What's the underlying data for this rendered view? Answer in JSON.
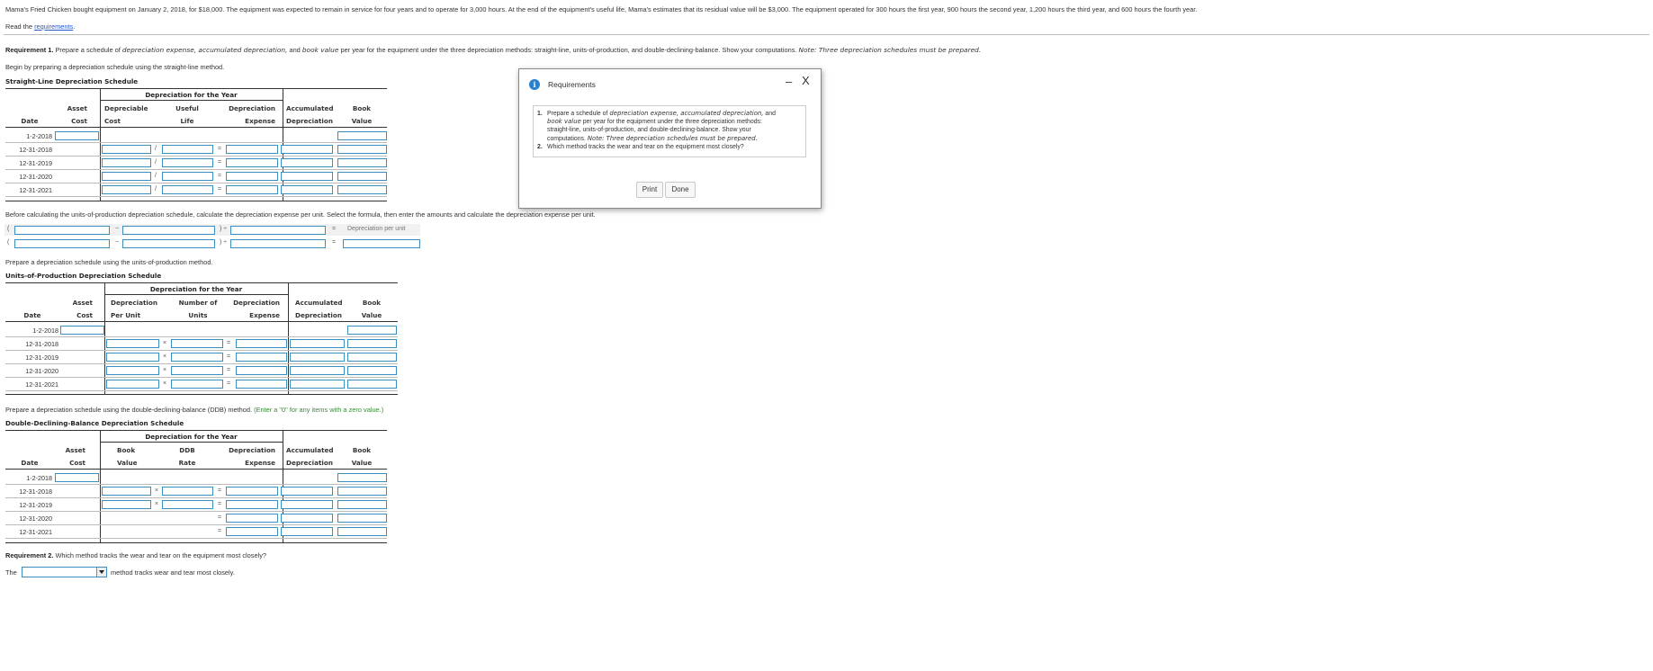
{
  "intro": {
    "problem": "Mama's Fried Chicken bought equipment on January 2, 2018, for $18,000. The equipment was expected to remain in service for four years and to operate for 3,000 hours. At the end of the equipment's useful life, Mama's estimates that its residual value will be $3,000. The equipment operated for 300 hours the first year, 900 hours the second year, 1,200 hours the third year, and 600 hours the fourth year.",
    "read_prefix": "Read the ",
    "read_link": "requirements",
    "read_suffix": "."
  },
  "req1": {
    "label": "Requirement 1.",
    "text_a": " Prepare a schedule of ",
    "term1": "depreciation expense, accumulated depreciation,",
    "text_b": " and ",
    "term2": "book value",
    "text_c": " per year for the equipment under the three depreciation methods: straight-line, units-of-production, and double-declining-balance. Show your computations. ",
    "note": "Note: Three depreciation schedules must be prepared.",
    "begin": "Begin by preparing a depreciation schedule using the straight-line method."
  },
  "sl": {
    "title": "Straight-Line Depreciation Schedule",
    "group_header": "Depreciation for the Year",
    "col_asset_1": "Asset",
    "col_asset_2": "Cost",
    "col_a_1": "Depreciable",
    "col_a_2": "Cost",
    "col_b_1": "Useful",
    "col_b_2": "Life",
    "col_c_1": "Depreciation",
    "col_c_2": "Expense",
    "col_d_1": "Accumulated",
    "col_d_2": "Depreciation",
    "col_e_1": "Book",
    "col_e_2": "Value",
    "col_date": "Date",
    "ops": [
      "/",
      "="
    ],
    "dates": [
      "1-2-2018",
      "12-31-2018",
      "12-31-2019",
      "12-31-2020",
      "12-31-2021"
    ]
  },
  "units_formula": {
    "intro": "Before calculating the units-of-production depreciation schedule, calculate the depreciation expense per unit. Select the formula, then enter the amounts and calculate the depreciation expense per unit.",
    "open_paren": "(",
    "minus": "−",
    "close_div": ") ÷",
    "equals": "=",
    "result_label": "Depreciation per unit",
    "prepare": "Prepare a depreciation schedule using the units-of-production method."
  },
  "uop": {
    "title": "Units-of-Production Depreciation Schedule",
    "group_header": "Depreciation for the Year",
    "col_asset_1": "Asset",
    "col_asset_2": "Cost",
    "col_a_1": "Depreciation",
    "col_a_2": "Per Unit",
    "col_b_1": "Number of",
    "col_b_2": "Units",
    "col_c_1": "Depreciation",
    "col_c_2": "Expense",
    "col_d_1": "Accumulated",
    "col_d_2": "Depreciation",
    "col_e_1": "Book",
    "col_e_2": "Value",
    "col_date": "Date",
    "ops": [
      "×",
      "="
    ],
    "dates": [
      "1-2-2018",
      "12-31-2018",
      "12-31-2019",
      "12-31-2020",
      "12-31-2021"
    ]
  },
  "ddb_intro": {
    "text": "Prepare a depreciation schedule using the double-declining-balance (DDB) method. ",
    "hint": "(Enter a \"0\" for any items with a zero value.)"
  },
  "ddb": {
    "title": "Double-Declining-Balance Depreciation Schedule",
    "group_header": "Depreciation for the Year",
    "col_asset_1": "Asset",
    "col_asset_2": "Cost",
    "col_a_1": "Book",
    "col_a_2": "Value",
    "col_b_1": "DDB",
    "col_b_2": "Rate",
    "col_c_1": "Depreciation",
    "col_c_2": "Expense",
    "col_d_1": "Accumulated",
    "col_d_2": "Depreciation",
    "col_e_1": "Book",
    "col_e_2": "Value",
    "col_date": "Date",
    "ops": [
      "×",
      "="
    ],
    "dates": [
      "1-2-2018",
      "12-31-2018",
      "12-31-2019",
      "12-31-2020",
      "12-31-2021"
    ]
  },
  "req2": {
    "label": "Requirement 2.",
    "text": " Which method tracks the wear and tear on the equipment most closely?",
    "prefix": "The",
    "select_value": "",
    "suffix": "method tracks wear and tear most closely."
  },
  "modal": {
    "title": "Requirements",
    "minimize": "–",
    "close": "X",
    "item1_num": "1.",
    "item1_a": "Prepare a schedule of ",
    "item1_term1": "depreciation expense, accumulated depreciation,",
    "item1_b": " and",
    "item1_term2": "book value",
    "item1_c": " per year for the equipment under the three depreciation methods:",
    "item1_d": "straight-line, units-of-production, and double-declining-balance. Show your",
    "item1_e": "computations. ",
    "item1_note": "Note: Three depreciation schedules must be prepared.",
    "item2_num": "2.",
    "item2": "Which method tracks the wear and tear on the equipment most closely?",
    "print_label": "Print",
    "done_label": "Done",
    "accent": "#2a7fd0"
  }
}
